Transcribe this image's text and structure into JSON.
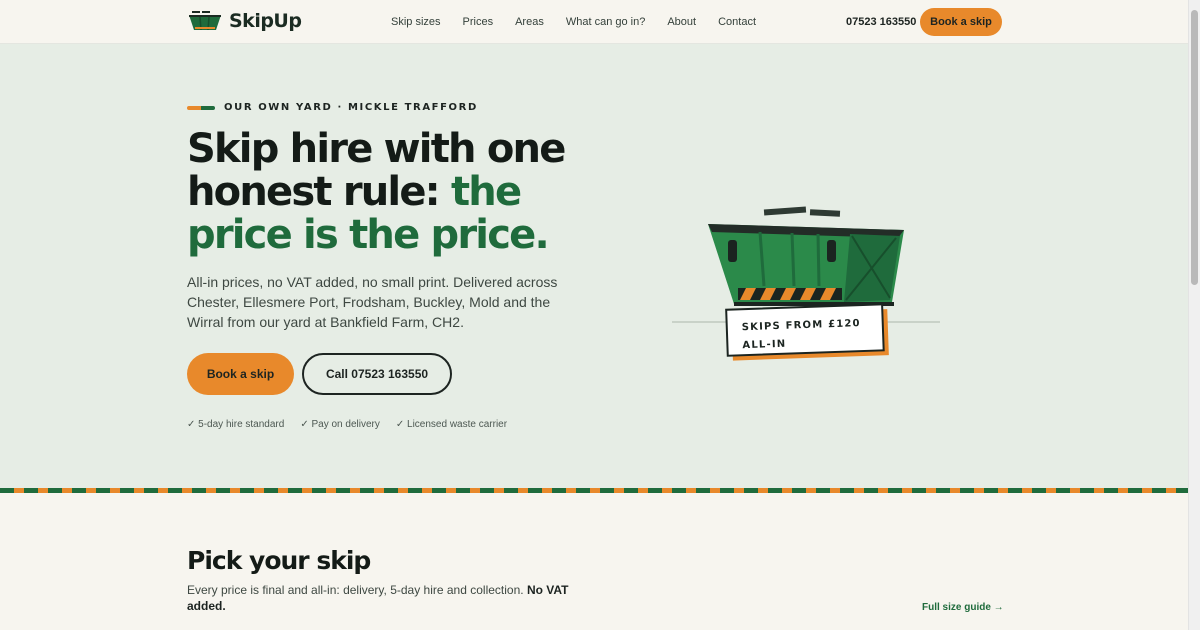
{
  "header": {
    "logo_text": "SkipUp",
    "logo_icon": "skip-icon",
    "nav": [
      "Skip sizes",
      "Prices",
      "Areas",
      "What can go in?",
      "About",
      "Contact"
    ],
    "phone": "07523 163550",
    "cta": "Book a skip"
  },
  "hero": {
    "eyebrow": "OUR OWN YARD · MICKLE TRAFFORD",
    "headline_plain": "Skip hire with one honest rule: ",
    "headline_accent": "the price is the price.",
    "lede": "All-in prices, no VAT added, no small print. Delivered across Chester, Ellesmere Port, Frodsham, Buckley, Mold and the Wirral from our yard at Bankfield Farm, CH2.",
    "primary_button": "Book a skip",
    "secondary_button": "Call 07523 163550",
    "trust": [
      "✓ 5-day hire standard",
      "✓ Pay on delivery",
      "✓ Licensed waste carrier"
    ],
    "price_tag_line1": "SKIPS FROM £120",
    "price_tag_line2": "ALL-IN"
  },
  "pick": {
    "title": "Pick your skip",
    "desc_plain": "Every price is final and all-in: delivery, 5-day hire and collection. ",
    "desc_bold": "No VAT added.",
    "link": "Full size guide →"
  },
  "colors": {
    "brand_green": "#1f6b3c",
    "accent_orange": "#e8892b",
    "hero_bg": "#e6ede5",
    "page_bg": "#f7f5ef"
  }
}
